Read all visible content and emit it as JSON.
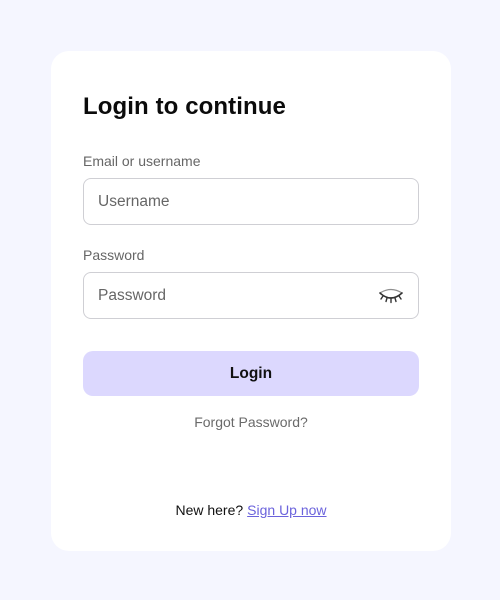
{
  "page": {
    "background": "#f5f6ff"
  },
  "card": {
    "title": "Login to continue"
  },
  "email_field": {
    "label": "Email or username",
    "placeholder": "Username",
    "value": ""
  },
  "password_field": {
    "label": "Password",
    "placeholder": "Password",
    "value": "",
    "toggle_icon": "eye-closed-icon"
  },
  "login_button": {
    "label": "Login",
    "color": "#dcd8fe"
  },
  "forgot_link": {
    "label": "Forgot Password?"
  },
  "signup": {
    "prompt": "New here?",
    "link_label": "Sign Up now",
    "link_color": "#6b63dc"
  }
}
